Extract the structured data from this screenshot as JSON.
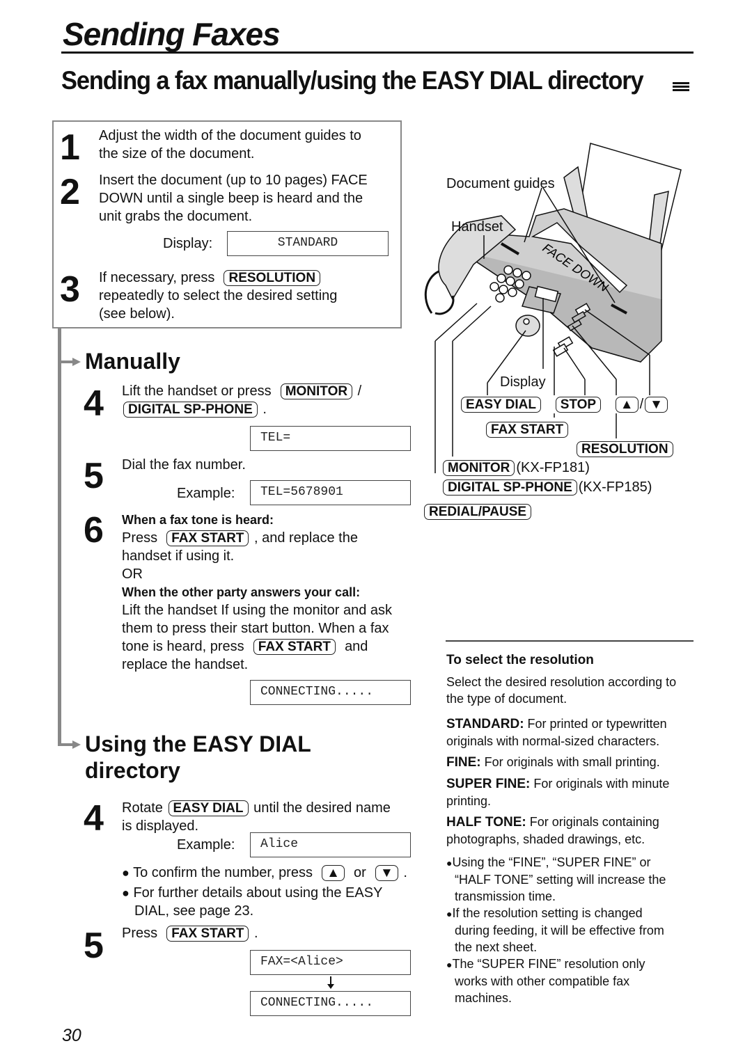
{
  "page": {
    "title": "Sending Faxes",
    "subtitle": "Sending a fax manually/using the EASY DIAL directory",
    "page_number": "30"
  },
  "intro_box": {
    "step1": {
      "num": "1",
      "line1": "Adjust the width of the document guides to",
      "line2": "the size of the document."
    },
    "step2": {
      "num": "2",
      "line1": "Insert the document (up to 10 pages) FACE",
      "line2": "DOWN until a single beep is heard and the",
      "line3": "unit grabs the document.",
      "display_label": "Display:",
      "display_value": "STANDARD"
    },
    "step3": {
      "num": "3",
      "prefix": "If necessary, press",
      "key": "RESOLUTION",
      "line2": "repeatedly to select the desired setting",
      "line3": "(see below)."
    }
  },
  "manually": {
    "heading": "Manually",
    "step4": {
      "num": "4",
      "prefix": "Lift the handset or press",
      "key1": "MONITOR",
      "sep": "/",
      "key2": "DIGITAL SP-PHONE",
      "suffix": ".",
      "display_value": "TEL="
    },
    "step5": {
      "num": "5",
      "text": "Dial the fax number.",
      "example_label": "Example:",
      "display_value": "TEL=5678901"
    },
    "step6": {
      "num": "6",
      "heading1": "When a fax tone is heard:",
      "press": "Press",
      "key": "FAX START",
      "after_key": ", and replace the",
      "line_b": "handset if using it.",
      "or": "OR",
      "heading2": "When the other party answers your call:",
      "p1": "Lift the handset If using the monitor and ask",
      "p2": "them to press their start button. When a fax",
      "p3_prefix": "tone is heard, press",
      "p3_key": "FAX START",
      "p3_suffix": "and",
      "p4": "replace the handset.",
      "display_value": "CONNECTING....."
    }
  },
  "easy_dial": {
    "heading_line1": "Using the EASY DIAL",
    "heading_line2": "directory",
    "step4": {
      "num": "4",
      "prefix": "Rotate",
      "key": "EASY DIAL",
      "suffix": "until the desired name",
      "line2": "is displayed.",
      "example_label": "Example:",
      "display_value": "Alice"
    },
    "bullets": [
      {
        "prefix": "To confirm the number, press",
        "key_up": "▲",
        "or": "or",
        "key_down": "▼",
        "suffix": "."
      },
      {
        "line1": "For further details about using the EASY",
        "line2": "DIAL, see page 23."
      }
    ],
    "step5": {
      "num": "5",
      "prefix": "Press",
      "key": "FAX START",
      "suffix": ".",
      "display1": "FAX=<Alice>",
      "display2": "CONNECTING....."
    }
  },
  "diagram": {
    "labels": {
      "document_guides": "Document guides",
      "handset": "Handset",
      "face_down": "FACE DOWN",
      "display": "Display"
    },
    "keys": {
      "easy_dial": "EASY DIAL",
      "stop": "STOP",
      "up": "▲",
      "slash": "/",
      "down": "▼",
      "fax_start": "FAX START",
      "resolution": "RESOLUTION",
      "monitor": "MONITOR",
      "monitor_model": "(KX-FP181)",
      "digital_sp_phone": "DIGITAL SP-PHONE",
      "digital_model": "(KX-FP185)",
      "redial_pause": "REDIAL/PAUSE"
    }
  },
  "resolution_info": {
    "heading": "To select the resolution",
    "intro1": "Select the desired resolution according to",
    "intro2": "the type of document.",
    "items": [
      {
        "term": "STANDARD:",
        "desc1": " For printed or typewritten",
        "desc2": "originals with normal-sized characters."
      },
      {
        "term": "FINE:",
        "desc1": " For originals with small printing.",
        "desc2": ""
      },
      {
        "term": "SUPER FINE:",
        "desc1": " For originals with minute",
        "desc2": "printing."
      },
      {
        "term": "HALF TONE:",
        "desc1": " For originals containing",
        "desc2": "photographs, shaded drawings, etc."
      }
    ],
    "notes": [
      {
        "l1": "Using the “FINE”, “SUPER FINE” or",
        "l2": "“HALF TONE” setting will increase the",
        "l3": "transmission time."
      },
      {
        "l1": "If the resolution setting is changed",
        "l2": "during feeding, it will be effective from",
        "l3": "the next sheet."
      },
      {
        "l1": "The “SUPER FINE” resolution only",
        "l2": "works with other compatible fax",
        "l3": "machines."
      }
    ]
  }
}
